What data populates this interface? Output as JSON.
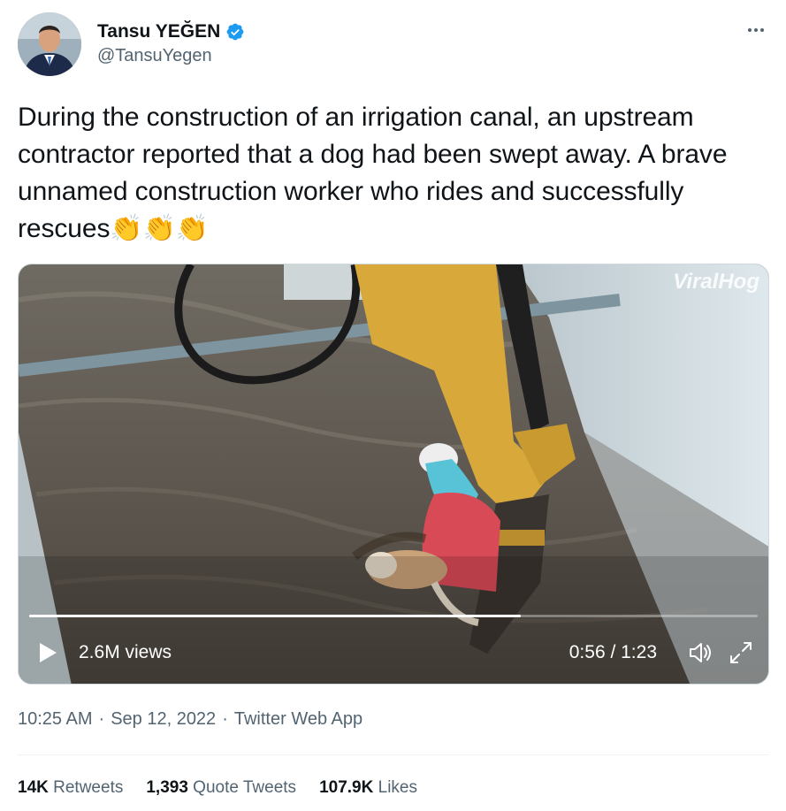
{
  "user": {
    "display_name": "Tansu YEĞEN",
    "handle": "@TansuYegen",
    "verified": true,
    "avatar_icon": "profile-photo"
  },
  "tweet": {
    "text": "During the construction of an irrigation canal, an upstream contractor reported that a dog had been swept away. A brave unnamed construction worker who rides and successfully rescues",
    "emoji": "👏👏👏"
  },
  "media": {
    "watermark": "ViralHog",
    "views": "2.6M views",
    "time": "0:56 / 1:23",
    "progress": 0.675,
    "play_icon": "play-icon",
    "volume_icon": "volume-icon",
    "fullscreen_icon": "fullscreen-icon"
  },
  "meta": {
    "time": "10:25 AM",
    "sep": "·",
    "date": "Sep 12, 2022",
    "app": "Twitter Web App"
  },
  "stats": {
    "retweets_count": "14K",
    "retweets_label": "Retweets",
    "quotes_count": "1,393",
    "quotes_label": "Quote Tweets",
    "likes_count": "107.9K",
    "likes_label": "Likes"
  },
  "colors": {
    "verified": "#1d9bf0",
    "secondary_text": "#536471",
    "primary_text": "#0f1419"
  }
}
